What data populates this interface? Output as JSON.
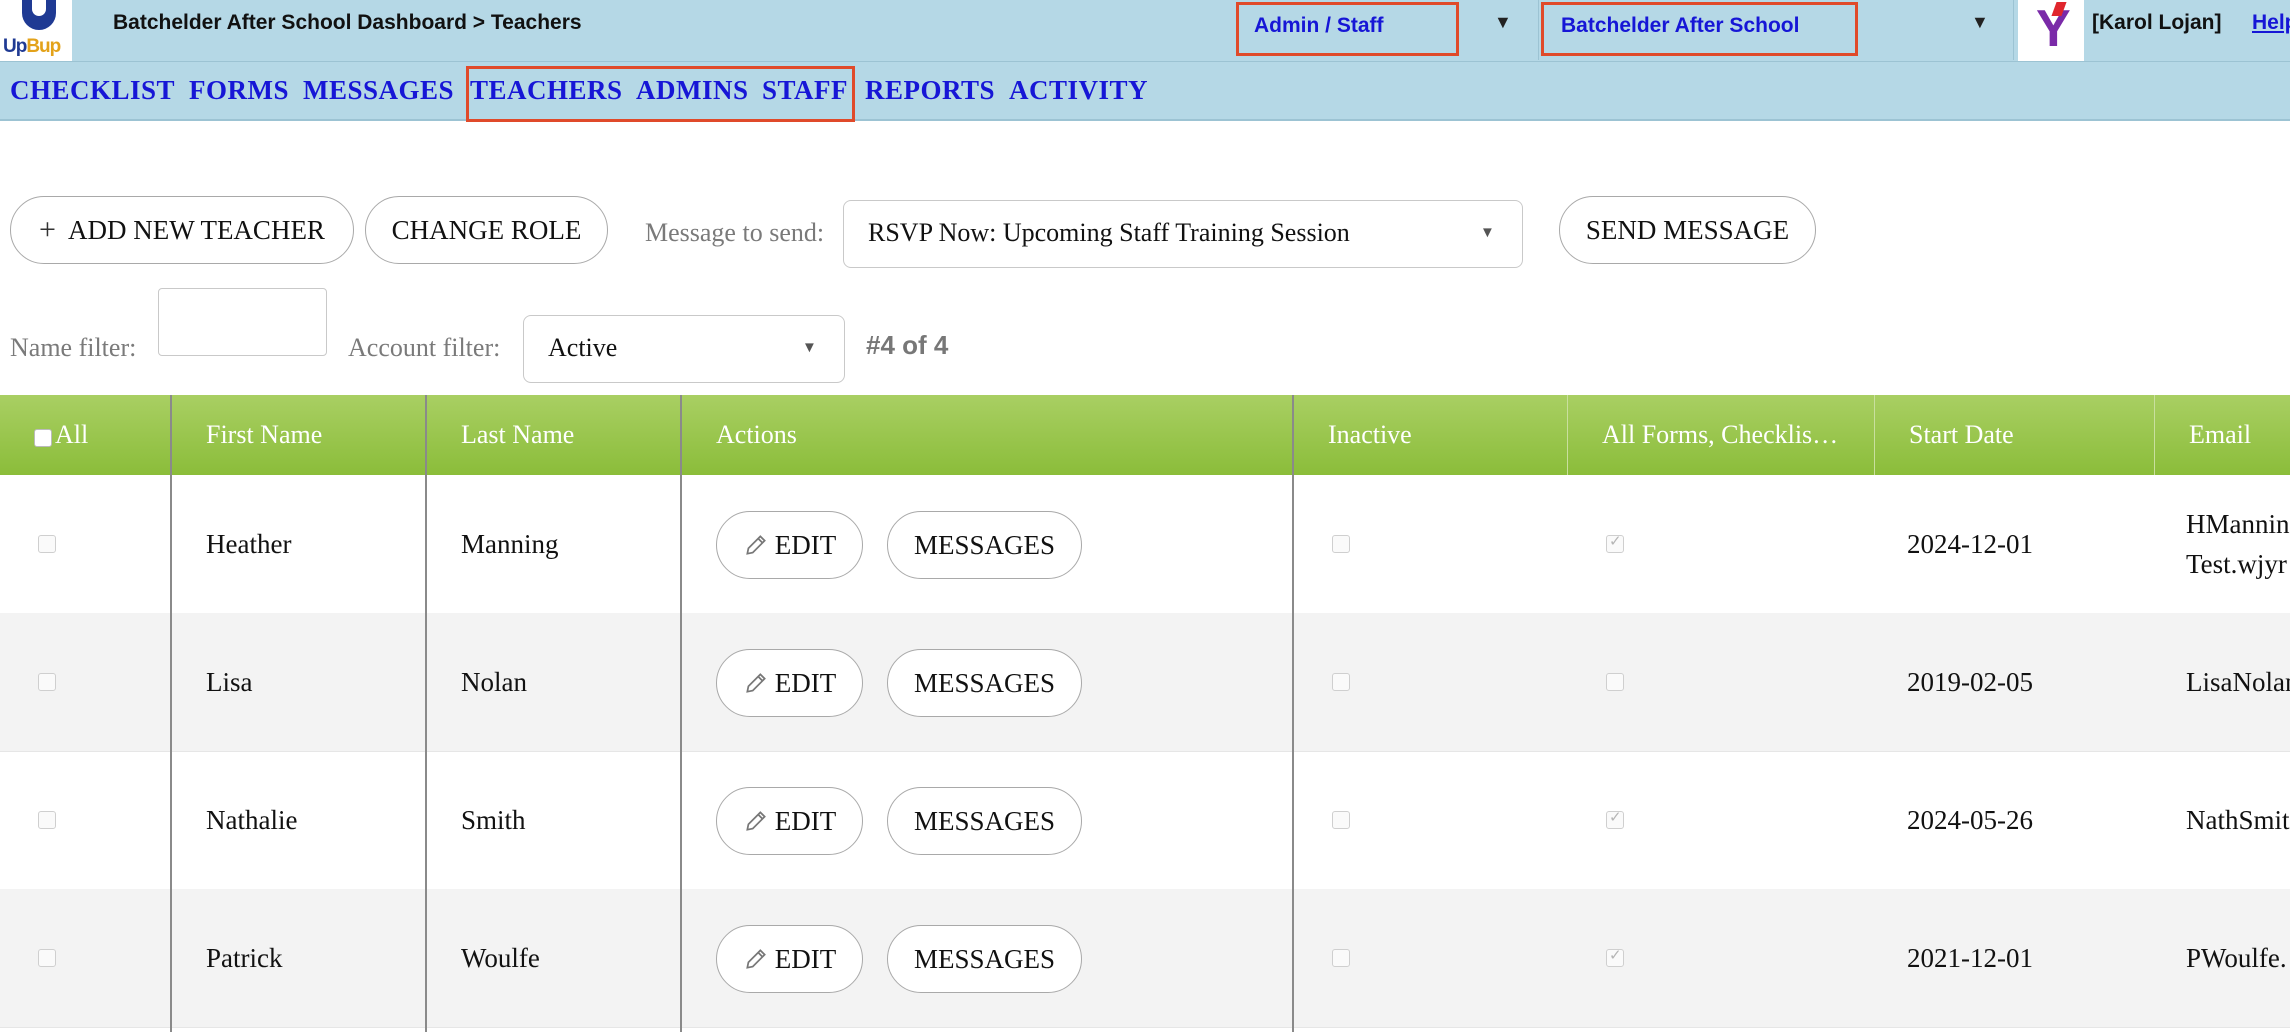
{
  "header": {
    "logo_text_a": "Up",
    "logo_text_b": "Bup",
    "breadcrumb": "Batchelder After School Dashboard > Teachers",
    "role_select": "Admin / Staff",
    "school_select": "Batchelder After School",
    "user": "[Karol Lojan]",
    "help": "Help"
  },
  "nav": [
    "CHECKLIST",
    "FORMS",
    "MESSAGES",
    "TEACHERS",
    "ADMINS",
    "STAFF",
    "REPORTS",
    "ACTIVITY"
  ],
  "toolbar": {
    "add_label": "ADD NEW TEACHER",
    "change_role_label": "CHANGE ROLE",
    "message_label": "Message to send:",
    "message_value": "RSVP Now: Upcoming Staff Training Session",
    "send_label": "SEND MESSAGE",
    "name_filter_label": "Name filter:",
    "name_filter_value": "",
    "account_filter_label": "Account filter:",
    "account_filter_value": "Active",
    "count": "#4 of 4"
  },
  "table": {
    "headers": {
      "select_all": "All",
      "first": "First Name",
      "last": "Last Name",
      "actions": "Actions",
      "inactive": "Inactive",
      "forms": "All Forms, Checklis…",
      "start": "Start Date",
      "email": "Email"
    },
    "edit_label": "EDIT",
    "messages_label": "MESSAGES",
    "rows": [
      {
        "first": "Heather",
        "last": "Manning",
        "inactive": false,
        "forms_complete": true,
        "start": "2024-12-01",
        "email_line1": "HMannin",
        "email_line2": "Test.wjyr"
      },
      {
        "first": "Lisa",
        "last": "Nolan",
        "inactive": false,
        "forms_complete": false,
        "start": "2019-02-05",
        "email_line1": "LisaNolan",
        "email_line2": ""
      },
      {
        "first": "Nathalie",
        "last": "Smith",
        "inactive": false,
        "forms_complete": true,
        "start": "2024-05-26",
        "email_line1": "NathSmit",
        "email_line2": ""
      },
      {
        "first": "Patrick",
        "last": "Woulfe",
        "inactive": false,
        "forms_complete": true,
        "start": "2021-12-01",
        "email_line1": "PWoulfe.",
        "email_line2": ""
      }
    ]
  },
  "colors": {
    "topbar": "#b5d8e6",
    "link": "#1616d6",
    "highlight": "#e04a2a",
    "table_header": "#8bbd3a"
  }
}
